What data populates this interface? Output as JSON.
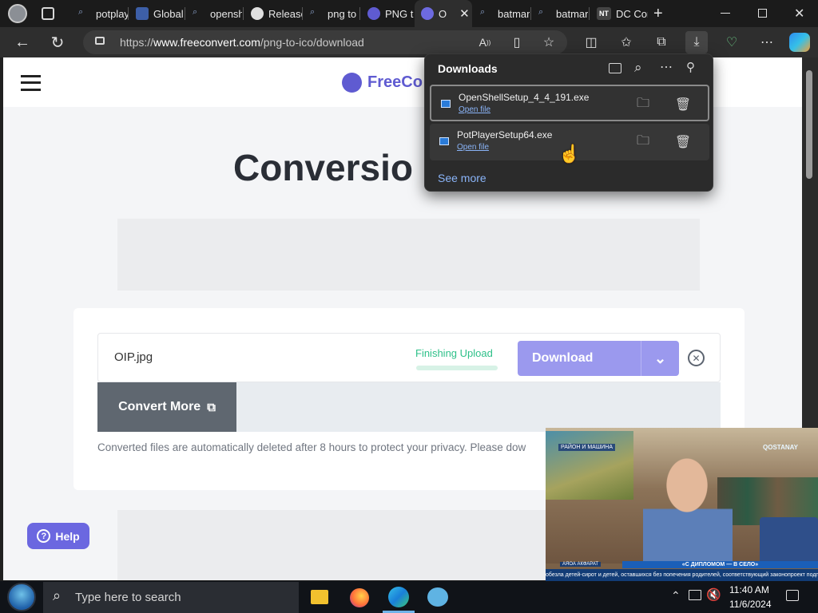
{
  "tabs": [
    {
      "label": "potplay",
      "icon": "search-icon"
    },
    {
      "label": "Global",
      "icon": "play-icon"
    },
    {
      "label": "opensh",
      "icon": "search-icon"
    },
    {
      "label": "Release",
      "icon": "github-icon"
    },
    {
      "label": "png to",
      "icon": "search-icon"
    },
    {
      "label": "PNG to",
      "icon": "freeconvert-icon"
    },
    {
      "label": "O",
      "icon": "freeconvert-icon",
      "active": true
    },
    {
      "label": "batmar",
      "icon": "search-icon"
    },
    {
      "label": "batmar",
      "icon": "search-icon"
    },
    {
      "label": "DC Cor",
      "icon": "nt-icon"
    }
  ],
  "address_bar": {
    "url_prefix": "https://",
    "url_domain": "www.freeconvert.com",
    "url_path": "/png-to-ico/download"
  },
  "site": {
    "logo_text": "FreeCo",
    "heading": "Conversio",
    "file_name": "OIP.jpg",
    "status": "Finishing Upload",
    "download_label": "Download",
    "convert_more_label": "Convert More",
    "notice": "Converted files are automatically deleted after 8 hours to protect your privacy. Please dow",
    "help_label": "Help",
    "accent": "#9b99ee",
    "status_color": "#2ec089"
  },
  "downloads_panel": {
    "title": "Downloads",
    "items": [
      {
        "name": "OpenShellSetup_4_4_191.exe",
        "action": "Open file"
      },
      {
        "name": "PotPlayerSetup64.exe",
        "action": "Open file"
      }
    ],
    "see_more": "See more"
  },
  "video_overlay": {
    "sign_text": "РАЙОН И МАШИНА",
    "channel": "QOSTANAY",
    "caption_name": "АЯОА АКФАРАТ",
    "caption_headline": "«С ДИПЛОМОМ — В СЕЛО»",
    "ticker": "обезла детей-сирот и детей, оставшихся без попечения родителей, соответствующий законопроект подписал"
  },
  "taskbar": {
    "search_placeholder": "Type here to search",
    "time": "11:40 AM",
    "date": "11/6/2024"
  }
}
